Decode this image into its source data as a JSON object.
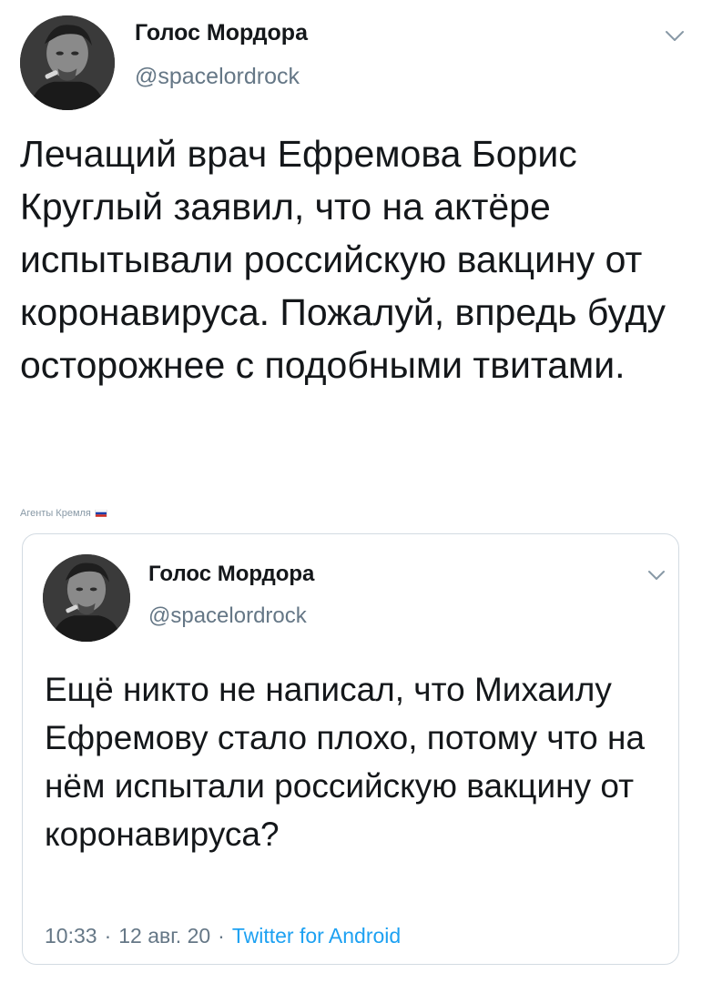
{
  "tweet": {
    "author": {
      "display_name": "Голос Мордора",
      "handle": "@spacelordrock",
      "avatar_icon": "user-avatar"
    },
    "menu_icon": "chevron-down-icon",
    "text": "Лечащий врач Ефремова Борис Круглый заявил, что на актёре испытывали российскую вакцину от коронавируса. Пожалуй, впредь буду осторожнее с подобными твитами.",
    "watermark": "Агенты Кремля",
    "watermark_icon": "russian-flag-icon"
  },
  "quoted_tweet": {
    "author": {
      "display_name": "Голос Мордора",
      "handle": "@spacelordrock",
      "avatar_icon": "user-avatar"
    },
    "menu_icon": "chevron-down-icon",
    "text": "Ещё никто не написал, что Михаилу Ефремову стало плохо, потому что на нём испытали российскую вакцину от коронавируса?",
    "time": "10:33",
    "date": "12 авг. 20",
    "separator": "·",
    "source": "Twitter for Android"
  },
  "colors": {
    "text_primary": "#14171a",
    "text_secondary": "#657786",
    "link": "#1da1f2",
    "border": "#d3dbe2"
  }
}
